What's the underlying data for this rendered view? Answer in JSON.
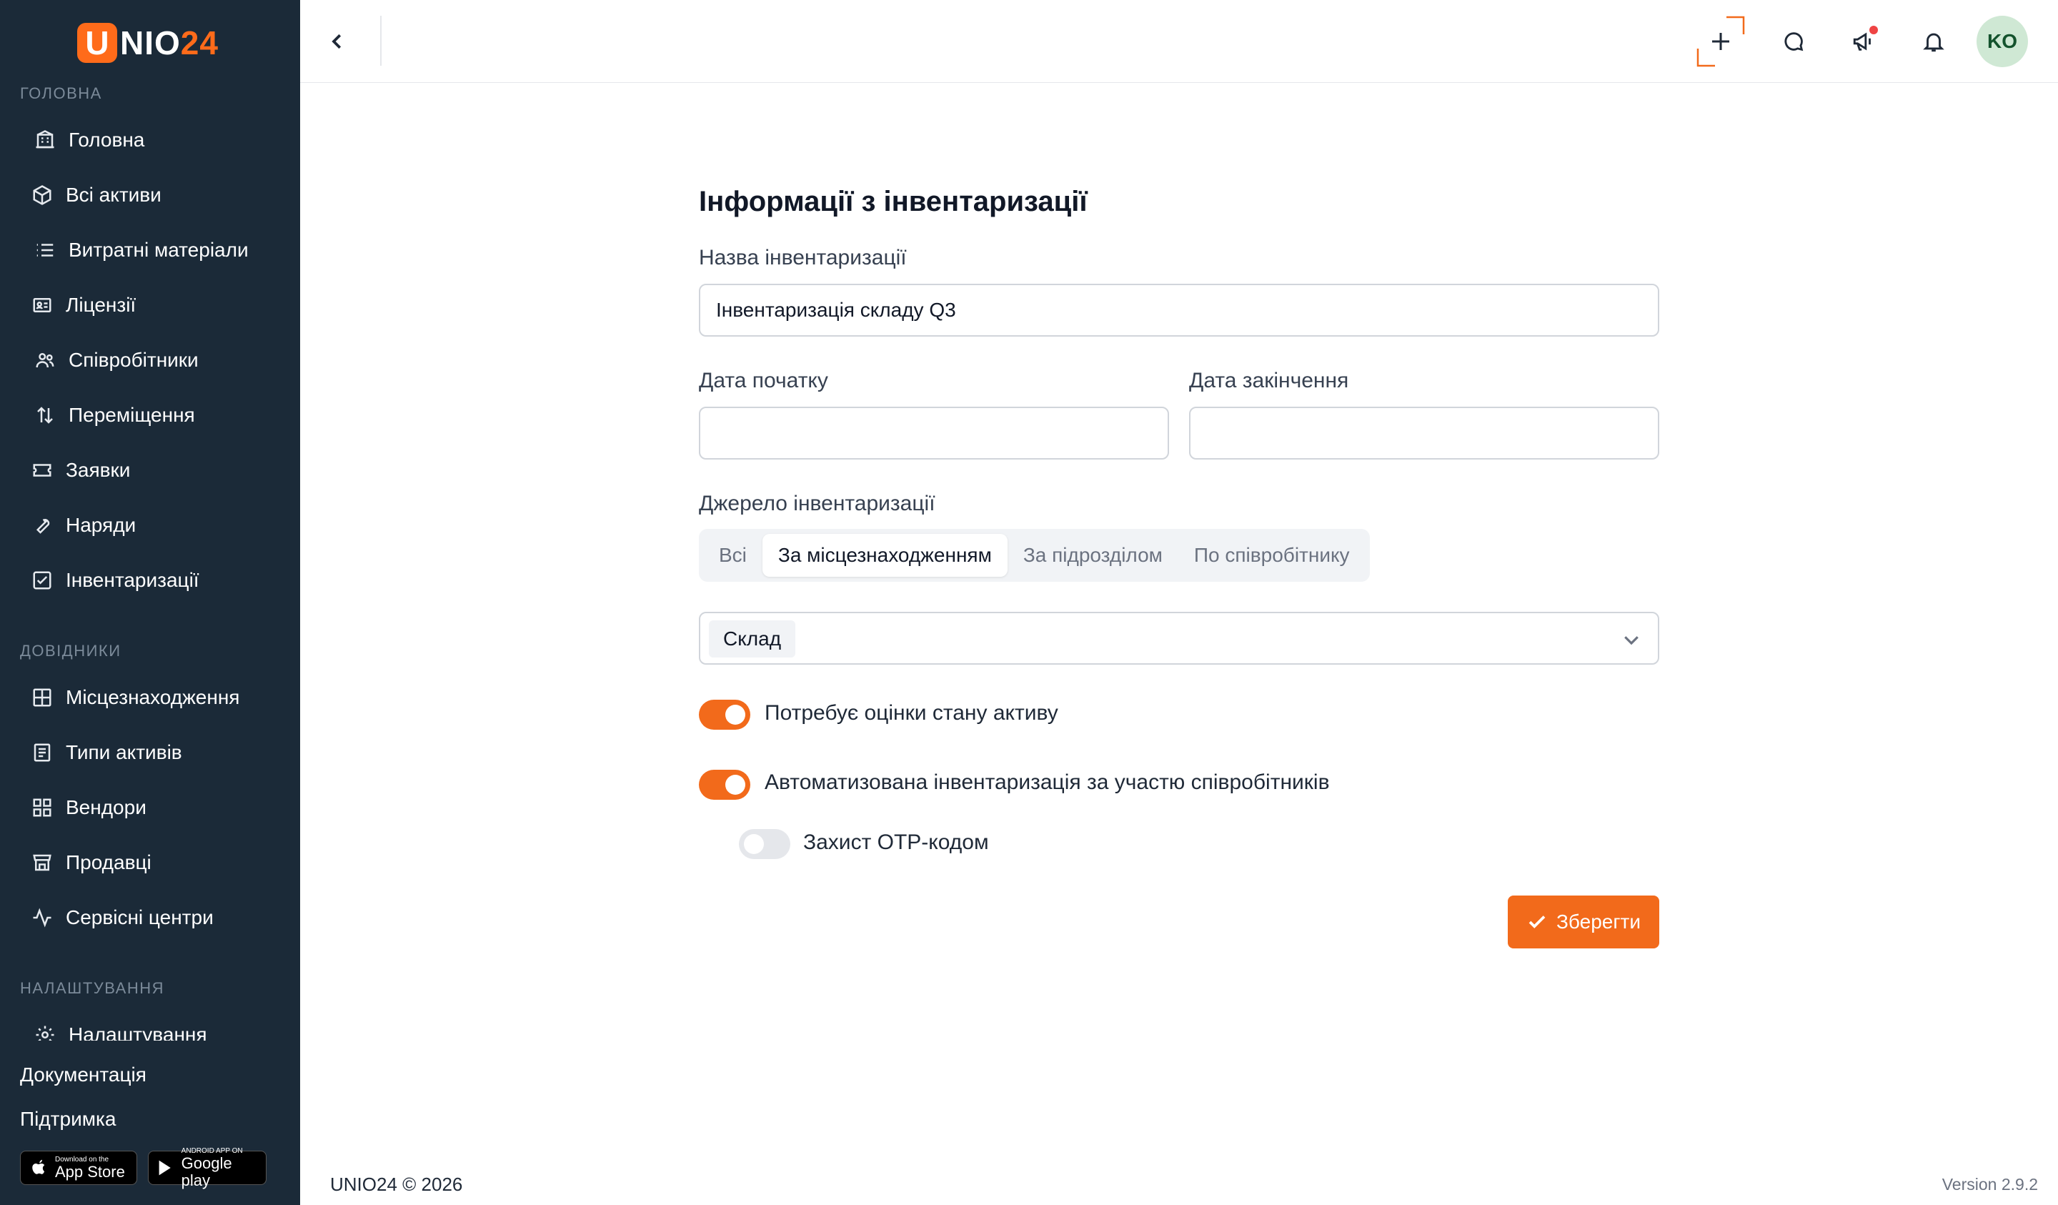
{
  "logo": {
    "letter": "U",
    "text": "NIO",
    "number": "24"
  },
  "sidebar": {
    "sections": [
      {
        "label": "ГОЛОВНА"
      },
      {
        "label": "ДОВІДНИКИ"
      },
      {
        "label": "НАЛАШТУВАННЯ"
      }
    ],
    "items": [
      {
        "label": "Головна",
        "icon": "building-icon"
      },
      {
        "label": "Всі активи",
        "icon": "box-icon"
      },
      {
        "label": "Витратні матеріали",
        "icon": "list-icon"
      },
      {
        "label": "Ліцензії",
        "icon": "id-card-icon"
      },
      {
        "label": "Співробітники",
        "icon": "users-icon"
      },
      {
        "label": "Переміщення",
        "icon": "arrows-updown-icon"
      },
      {
        "label": "Заявки",
        "icon": "ticket-icon"
      },
      {
        "label": "Наряди",
        "icon": "wrench-icon"
      },
      {
        "label": "Інвентаризації",
        "icon": "checkbox-icon"
      },
      {
        "label": "Місцезнаходження",
        "icon": "grid-icon"
      },
      {
        "label": "Типи активів",
        "icon": "document-icon"
      },
      {
        "label": "Вендори",
        "icon": "blocks-icon"
      },
      {
        "label": "Продавці",
        "icon": "store-icon"
      },
      {
        "label": "Сервісні центри",
        "icon": "activity-icon"
      },
      {
        "label": "Налаштування",
        "icon": "gear-icon"
      }
    ],
    "docs_link": "Документація",
    "support_link": "Підтримка",
    "app_store": {
      "small": "Download on the",
      "big": "App Store"
    },
    "google_play": {
      "small": "ANDROID APP ON",
      "big": "Google play"
    }
  },
  "header": {
    "icons": [
      "chevron-left-icon",
      "plus-icon",
      "chat-icon",
      "megaphone-icon",
      "bell-icon"
    ],
    "avatar": "KO"
  },
  "form": {
    "title": "Інформації з інвентаризації",
    "name_label": "Назва інвентаризації",
    "name_value": "Інвентаризація складу Q3",
    "start_label": "Дата початку",
    "start_value": "",
    "end_label": "Дата закінчення",
    "end_value": "",
    "source_label": "Джерело інвентаризації",
    "source_options": [
      "Всі",
      "За місцезнаходженням",
      "За підрозділом",
      "По співробітнику"
    ],
    "source_selected": "За місцезнаходженням",
    "location_chip": "Склад",
    "toggle_condition": {
      "label": "Потребує оцінки стану активу",
      "on": true
    },
    "toggle_auto": {
      "label": "Автоматизована інвентаризація за участю співробітників",
      "on": true
    },
    "toggle_otp": {
      "label": "Захист OTP-кодом",
      "on": false
    },
    "save_label": "Зберегти"
  },
  "footer": {
    "copyright": "UNIO24 © 2026",
    "version": "Version 2.9.2"
  },
  "colors": {
    "accent": "#f26a1b",
    "sidebar_bg": "#1b2a38",
    "avatar_bg": "#cfe8d4"
  }
}
